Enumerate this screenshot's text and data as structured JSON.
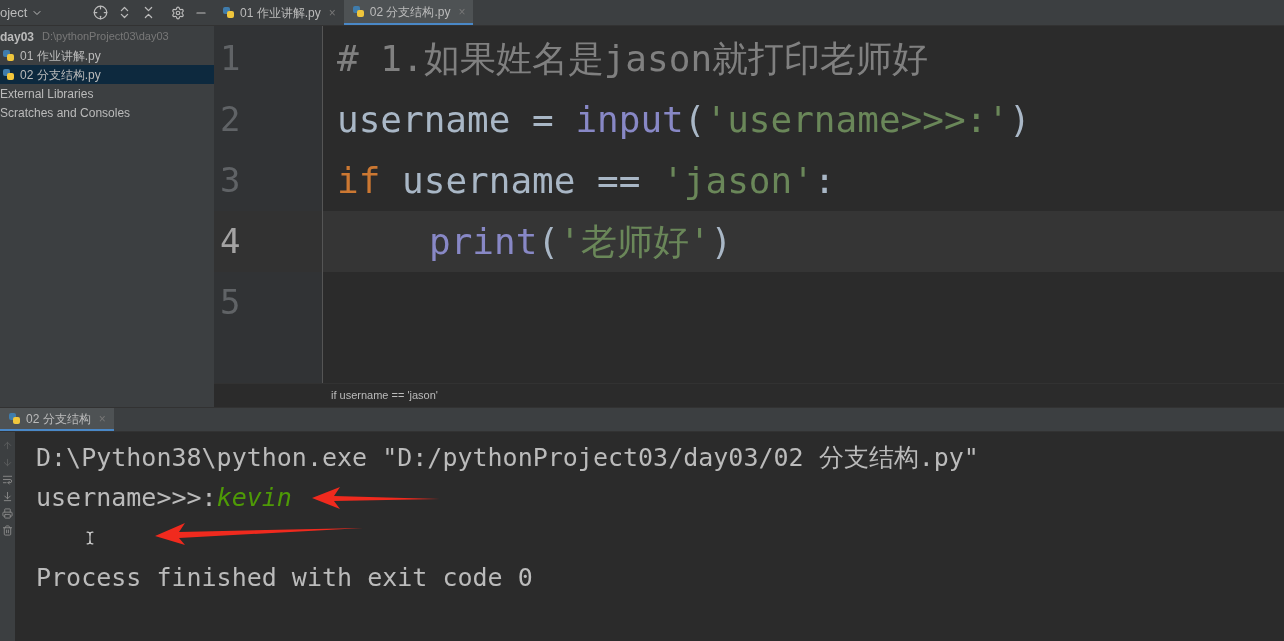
{
  "project_panel": {
    "title": "oject",
    "tree": [
      {
        "name": "day03",
        "path": "D:\\pythonProject03\\day03",
        "kind": "folder",
        "selected": false,
        "children": [
          {
            "name": "01 作业讲解.py",
            "kind": "python",
            "selected": false
          },
          {
            "name": "02 分支结构.py",
            "kind": "python",
            "selected": true
          }
        ]
      },
      {
        "name": "External Libraries",
        "kind": "plain",
        "selected": false
      },
      {
        "name": "Scratches and Consoles",
        "kind": "plain",
        "selected": false
      }
    ]
  },
  "editor_tabs": [
    {
      "label": "01 作业讲解.py",
      "close": "×",
      "selected": false
    },
    {
      "label": "02 分支结构.py",
      "close": "×",
      "selected": true
    }
  ],
  "editor": {
    "lines": [
      {
        "number": "1",
        "current": false,
        "tokens": [
          {
            "text": "# 1.如果姓名是jason就打印老师好",
            "kind": "comment"
          }
        ]
      },
      {
        "number": "2",
        "current": false,
        "tokens": [
          {
            "text": "username = ",
            "kind": "plain"
          },
          {
            "text": "input",
            "kind": "builtin"
          },
          {
            "text": "(",
            "kind": "plain"
          },
          {
            "text": "'username>>>:'",
            "kind": "string"
          },
          {
            "text": ")",
            "kind": "plain"
          }
        ]
      },
      {
        "number": "3",
        "current": false,
        "tokens": [
          {
            "text": "if",
            "kind": "keyword"
          },
          {
            "text": " username == ",
            "kind": "plain"
          },
          {
            "text": "'jason'",
            "kind": "string"
          },
          {
            "text": ":",
            "kind": "plain"
          }
        ]
      },
      {
        "number": "4",
        "current": true,
        "indented": true,
        "tokens": [
          {
            "text": "print",
            "kind": "builtin"
          },
          {
            "text": "(",
            "kind": "plain"
          },
          {
            "text": "'老师好'",
            "kind": "string"
          },
          {
            "text": ")",
            "kind": "plain"
          }
        ]
      },
      {
        "number": "5",
        "current": false
      }
    ],
    "breadcrumb": "if username == 'jason'"
  },
  "run_panel": {
    "tab": {
      "label": "02 分支结构",
      "close": "×",
      "selected": true
    },
    "lines": [
      {
        "tokens": [
          {
            "text": "D:\\Python38\\python.exe \"D:/pythonProject03/day03/02 分支结构.py\"",
            "kind": "output"
          }
        ]
      },
      {
        "tokens": [
          {
            "text": "username>>>:",
            "kind": "output"
          },
          {
            "text": "kevin",
            "kind": "input"
          }
        ]
      },
      {
        "kind": "cursor"
      },
      {
        "tokens": [
          {
            "text": "Process finished with exit code 0",
            "kind": "output"
          }
        ]
      }
    ]
  }
}
